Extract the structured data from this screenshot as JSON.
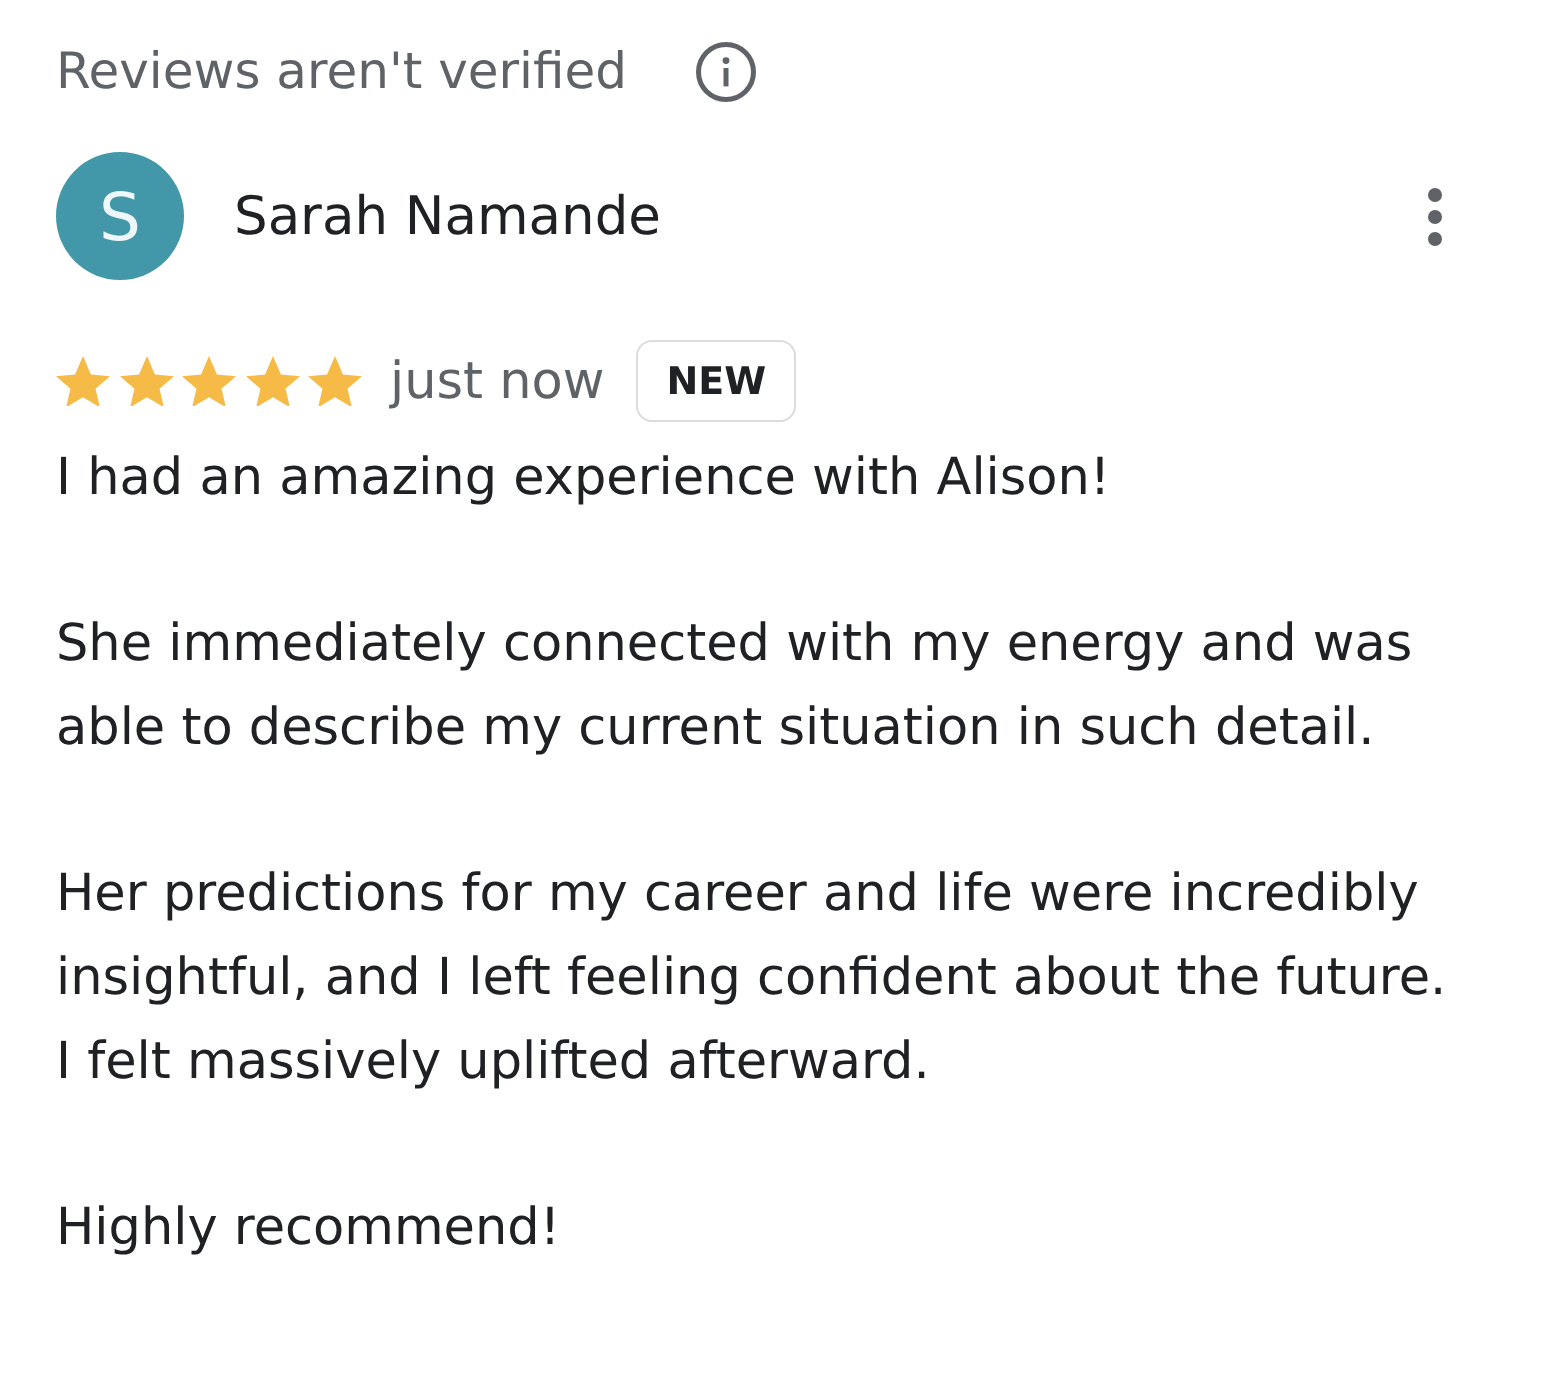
{
  "notice": {
    "text": "Reviews aren't verified"
  },
  "review": {
    "author": {
      "initial": "S",
      "name": "Sarah Namande"
    },
    "stars": 5,
    "time": "just now",
    "badge": "NEW",
    "paragraphs": [
      "I had an amazing experience with Alison!",
      "She immediately connected with my energy and was able to describe my current situation in such detail.",
      "Her predictions for my career and life were incredibly insightful, and I left feeling confident about the future. I felt massively uplifted afterward.",
      "Highly recommend!"
    ]
  }
}
